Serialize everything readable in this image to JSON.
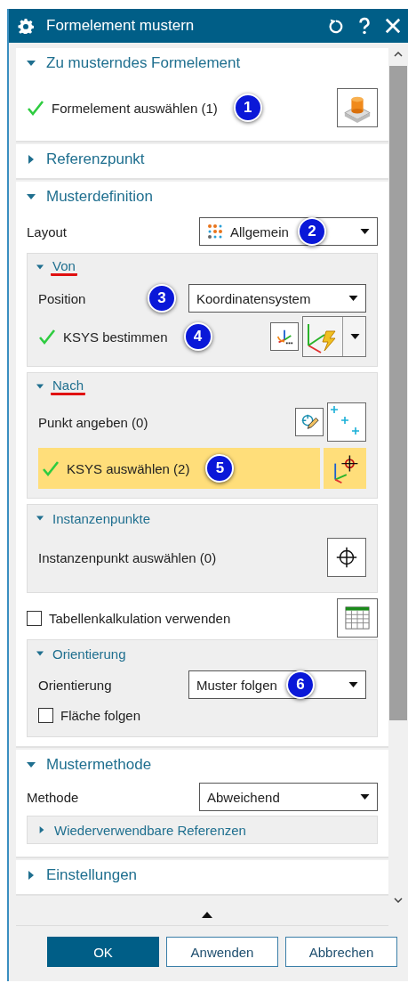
{
  "window": {
    "title": "Formelement mustern"
  },
  "feature_section": {
    "title": "Zu musterndes Formelement",
    "expanded": true,
    "select_row": {
      "label": "Formelement auswählen (1)",
      "done": true,
      "badge": "1"
    }
  },
  "reference_section": {
    "title": "Referenzpunkt",
    "expanded": false
  },
  "pattern_section": {
    "title": "Musterdefinition",
    "expanded": true,
    "layout": {
      "label": "Layout",
      "value": "Allgemein",
      "badge": "2"
    },
    "from_group": {
      "title": "Von",
      "expanded": true,
      "underlined": true,
      "position": {
        "label": "Position",
        "value": "Koordinatensystem",
        "badge": "3"
      },
      "csys_row": {
        "label": "KSYS bestimmen",
        "done": true,
        "badge": "4"
      }
    },
    "to_group": {
      "title": "Nach",
      "expanded": true,
      "underlined": true,
      "point_row": {
        "label": "Punkt angeben (0)",
        "done": false,
        "selected": false
      },
      "csys_row": {
        "label": "KSYS auswählen (2)",
        "done": true,
        "selected": true,
        "badge": "5"
      }
    },
    "instance_group": {
      "title": "Instanzenpunkte",
      "expanded": true,
      "underlined": false,
      "row": {
        "label": "Instanzenpunkt auswählen (0)"
      }
    },
    "spreadsheet": {
      "label": "Tabellenkalkulation verwenden",
      "checked": false
    },
    "orientation_group": {
      "title": "Orientierung",
      "expanded": true,
      "underlined": false,
      "orientation": {
        "label": "Orientierung",
        "value": "Muster folgen",
        "badge": "6"
      },
      "follow_face": {
        "label": "Fläche folgen",
        "checked": false
      }
    }
  },
  "method_section": {
    "title": "Mustermethode",
    "expanded": true,
    "method": {
      "label": "Methode",
      "value": "Abweichend"
    },
    "reusable": {
      "title": "Wiederverwendbare Referenzen",
      "expanded": false
    }
  },
  "settings_section": {
    "title": "Einstellungen",
    "expanded": false
  },
  "buttons": [
    {
      "label": "OK",
      "kind": "primary"
    },
    {
      "label": "Anwenden",
      "kind": "secondary"
    },
    {
      "label": "Abbrechen",
      "kind": "secondary"
    }
  ]
}
